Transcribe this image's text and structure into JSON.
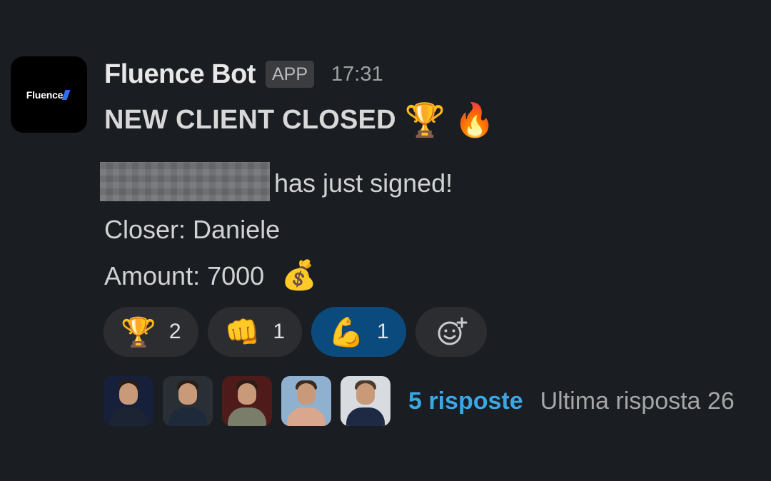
{
  "message": {
    "avatar_logo_text": "Fluence",
    "sender": "Fluence Bot",
    "badge": "APP",
    "time": "17:31",
    "title": "NEW CLIENT CLOSED",
    "title_emojis": [
      "🏆",
      "🔥"
    ],
    "signed_text": "has just signed!",
    "closer_line": "Closer: Daniele",
    "amount_line": "Amount: 7000",
    "amount_emoji": "💰"
  },
  "reactions": [
    {
      "emoji": "🏆",
      "icon": "trophy-icon",
      "count": "2",
      "active": false
    },
    {
      "emoji": "👊",
      "icon": "fist-bump-icon",
      "count": "1",
      "active": false
    },
    {
      "emoji": "💪",
      "icon": "flexed-biceps-icon",
      "count": "1",
      "active": true
    }
  ],
  "add_reaction_icon": "add-reaction-icon",
  "thread": {
    "participants": 5,
    "replies_label": "5 risposte",
    "last_reply_label": "Ultima risposta 26"
  },
  "colors": {
    "background": "#1a1d21",
    "active_reaction": "#0b4a7c",
    "link_blue": "#3ba7e5",
    "reaction_bg": "#2b2d31"
  }
}
